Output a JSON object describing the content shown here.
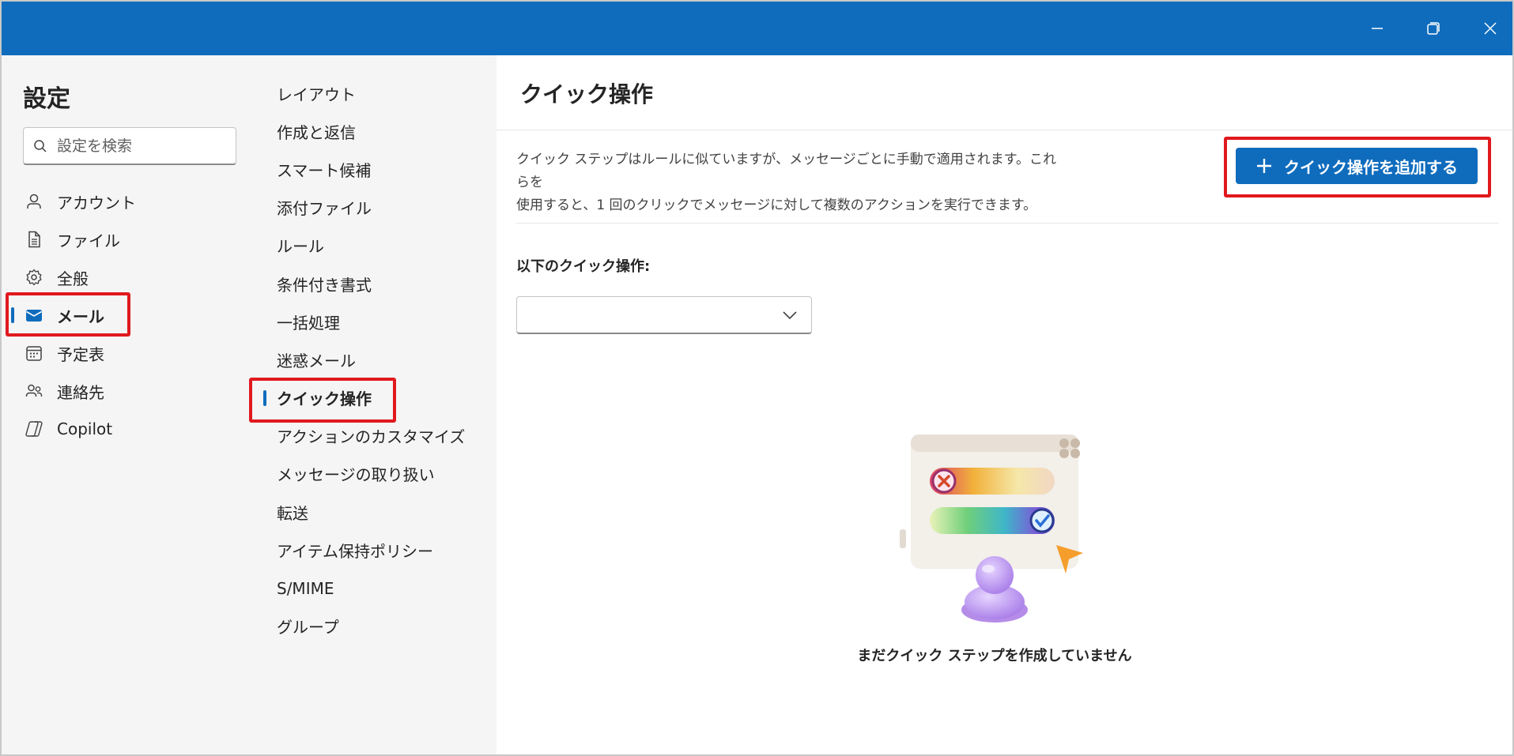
{
  "window": {
    "title_bar_color": "#0f6cbd",
    "controls": [
      "minimize-icon",
      "restore-icon",
      "close-icon"
    ]
  },
  "settings": {
    "title": "設定",
    "search_placeholder": "設定を検索"
  },
  "primary_nav": {
    "items": [
      {
        "label": "アカウント",
        "icon": "person-icon",
        "active": false
      },
      {
        "label": "ファイル",
        "icon": "document-icon",
        "active": false
      },
      {
        "label": "全般",
        "icon": "gear-icon",
        "active": false
      },
      {
        "label": "メール",
        "icon": "mail-icon",
        "active": true
      },
      {
        "label": "予定表",
        "icon": "calendar-icon",
        "active": false
      },
      {
        "label": "連絡先",
        "icon": "people-icon",
        "active": false
      },
      {
        "label": "Copilot",
        "icon": "copilot-icon",
        "active": false
      }
    ]
  },
  "secondary_nav": {
    "items": [
      {
        "label": "レイアウト",
        "active": false
      },
      {
        "label": "作成と返信",
        "active": false
      },
      {
        "label": "スマート候補",
        "active": false
      },
      {
        "label": "添付ファイル",
        "active": false
      },
      {
        "label": "ルール",
        "active": false
      },
      {
        "label": "条件付き書式",
        "active": false
      },
      {
        "label": "一括処理",
        "active": false
      },
      {
        "label": "迷惑メール",
        "active": false
      },
      {
        "label": "クイック操作",
        "active": true
      },
      {
        "label": "アクションのカスタマイズ",
        "active": false
      },
      {
        "label": "メッセージの取り扱い",
        "active": false
      },
      {
        "label": "転送",
        "active": false
      },
      {
        "label": "アイテム保持ポリシー",
        "active": false
      },
      {
        "label": "S/MIME",
        "active": false
      },
      {
        "label": "グループ",
        "active": false
      }
    ]
  },
  "main": {
    "title": "クイック操作",
    "description_line1": "クイック ステップはルールに似ていますが、メッセージごとに手動で適用されます。これらを",
    "description_line2": "使用すると、1 回のクリックでメッセージに対して複数のアクションを実行できます。",
    "add_button_label": "クイック操作を追加する",
    "list_label": "以下のクイック操作:",
    "dropdown_value": "",
    "empty_state_text": "まだクイック ステップを作成していません"
  },
  "colors": {
    "accent": "#0f6cbd",
    "highlight_box": "#e0191e",
    "pane_background": "#f5f5f5"
  }
}
